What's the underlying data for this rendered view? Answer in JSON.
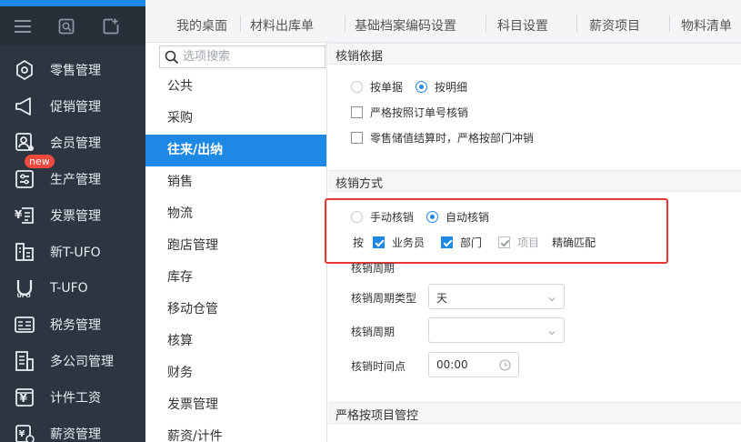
{
  "nav": {
    "items": [
      {
        "label": "零售管理",
        "icon": "retail-icon"
      },
      {
        "label": "促销管理",
        "icon": "megaphone-icon"
      },
      {
        "label": "会员管理",
        "icon": "member-icon"
      },
      {
        "label": "生产管理",
        "icon": "production-icon",
        "badge": "new"
      },
      {
        "label": "发票管理",
        "icon": "invoice-icon"
      },
      {
        "label": "新T-UFO",
        "icon": "building-icon"
      },
      {
        "label": "T-UFO",
        "icon": "ufo-icon"
      },
      {
        "label": "税务管理",
        "icon": "tax-icon"
      },
      {
        "label": "多公司管理",
        "icon": "multi-company-icon"
      },
      {
        "label": "计件工资",
        "icon": "piecework-icon"
      },
      {
        "label": "薪资管理",
        "icon": "salary-icon"
      }
    ]
  },
  "tabs": [
    "我的桌面",
    "材料出库单",
    "基础档案编码设置",
    "科目设置",
    "薪资项目",
    "物料清单"
  ],
  "options": {
    "search_placeholder": "选项搜索",
    "items": [
      "公共",
      "采购",
      "往来/出纳",
      "销售",
      "物流",
      "跑店管理",
      "库存",
      "移动仓管",
      "核算",
      "财务",
      "发票管理",
      "薪资/计件"
    ],
    "active_index": 2
  },
  "settings": {
    "basis": {
      "title": "核销依据",
      "radio_doc": "按单据",
      "radio_detail": "按明细",
      "chk_order": "严格按照订单号核销",
      "chk_retail": "零售储值结算时，严格按部门冲销"
    },
    "method": {
      "title": "核销方式",
      "radio_manual": "手动核销",
      "radio_auto": "自动核销",
      "by_label": "按",
      "chk_salesman": "业务员",
      "chk_dept": "部门",
      "chk_project": "项目",
      "exact_match": "精确匹配"
    },
    "period": {
      "title": "核销周期",
      "type_label": "核销周期类型",
      "type_value": "天",
      "period_label": "核销周期",
      "period_value": "",
      "time_label": "核销时间点",
      "time_value": "00:00"
    },
    "strict_project": {
      "title": "严格按项目管控"
    }
  },
  "colors": {
    "nav_bg": "#2c3540",
    "accent": "#1e88e5",
    "highlight_box": "#e53935",
    "badge": "#f04a3e"
  }
}
